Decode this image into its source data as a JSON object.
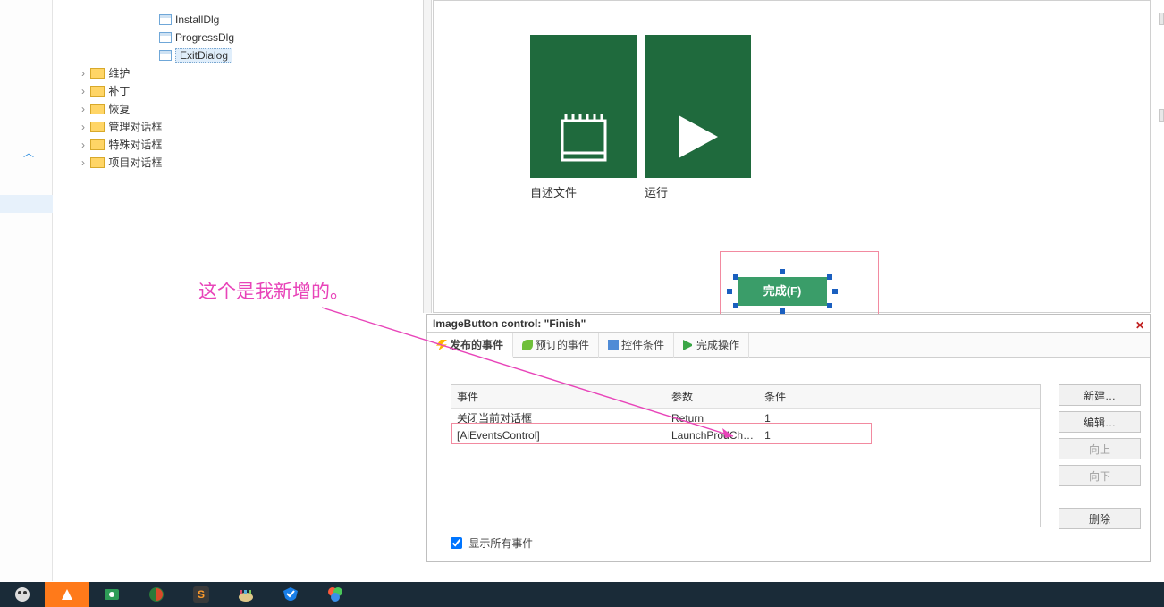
{
  "tree": {
    "items": [
      {
        "indent": 68,
        "icon": "dlg",
        "label": "InstallDlg",
        "selected": false,
        "caret": ""
      },
      {
        "indent": 68,
        "icon": "dlg",
        "label": "ProgressDlg",
        "selected": false,
        "caret": ""
      },
      {
        "indent": 68,
        "icon": "dlg",
        "label": "ExitDialog",
        "selected": true,
        "caret": ""
      },
      {
        "indent": 28,
        "icon": "fld",
        "label": "维护",
        "selected": false,
        "caret": "›"
      },
      {
        "indent": 28,
        "icon": "fld",
        "label": "补丁",
        "selected": false,
        "caret": "›"
      },
      {
        "indent": 28,
        "icon": "fld",
        "label": "恢复",
        "selected": false,
        "caret": "›"
      },
      {
        "indent": 28,
        "icon": "fld",
        "label": "管理对话框",
        "selected": false,
        "caret": "›"
      },
      {
        "indent": 28,
        "icon": "fld",
        "label": "特殊对话框",
        "selected": false,
        "caret": "›"
      },
      {
        "indent": 28,
        "icon": "fld",
        "label": "项目对话框",
        "selected": false,
        "caret": "›"
      }
    ]
  },
  "tiles": {
    "readme": "自述文件",
    "run": "运行"
  },
  "finish": {
    "label": "完成(F)"
  },
  "panel": {
    "title": "ImageButton control: \"Finish\"",
    "tabs": [
      "发布的事件",
      "预订的事件",
      "控件条件",
      "完成操作"
    ],
    "headers": {
      "event": "事件",
      "args": "参数",
      "cond": "条件"
    },
    "rows": [
      {
        "event": "关闭当前对话框",
        "args": "Return",
        "cond": "1"
      },
      {
        "event": "[AiEventsControl]",
        "args": "LaunchProdCh…",
        "cond": "1"
      }
    ],
    "buttons": {
      "new": "新建…",
      "edit": "编辑…",
      "up": "向上",
      "down": "向下",
      "del": "删除"
    },
    "checkbox": "显示所有事件"
  },
  "annotation": "这个是我新增的。"
}
